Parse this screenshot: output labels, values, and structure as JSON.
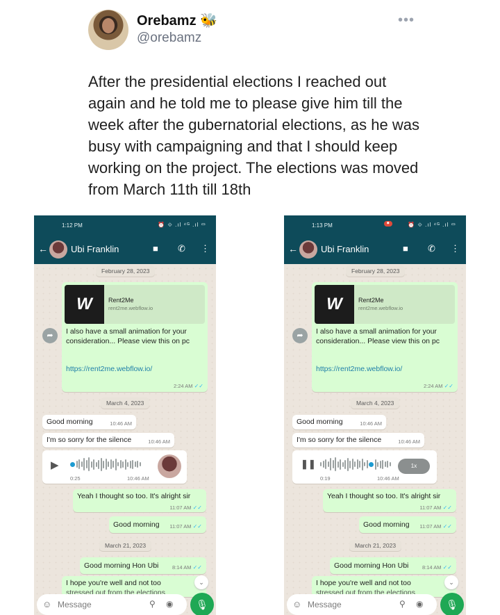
{
  "tweet": {
    "display_name": "Orebamz 🐝",
    "handle": "@orebamz",
    "more": "•••",
    "text": "After the presidential elections I reached out again and he told me to please give him till the week after the gubernatorial elections, as he was busy with campaigning and that I should keep working on the project. The elections was moved from March 11th till 18th"
  },
  "left": {
    "status_time": "1:12 PM",
    "status_icons": "⏰ ⟐ .ıl ⁴ᴳ .ıl ▭",
    "contact_name": "Ubi Franklin",
    "voice_duration": "0:25"
  },
  "right": {
    "status_time": "1:13 PM",
    "status_rec": "⏺",
    "status_icons": "⏰ ⟐ .ıl ⁴ᴳ .ıl ▭",
    "contact_name": "Ubi Franklin",
    "voice_duration": "0:19",
    "voice_speed": "1x"
  },
  "chat": {
    "date1": "February 28, 2023",
    "link_logo": "W",
    "link_title": "Rent2Me",
    "link_domain": "rent2me.webflow.io",
    "link_msg": "I also have a small animation for your consideration... Please view this on pc",
    "link_url": "https://rent2me.webflow.io/",
    "link_time": "2:24 AM",
    "date2": "March 4, 2023",
    "msg_good_morning": "Good morning",
    "msg_good_morning_time": "10:46 AM",
    "msg_sorry": "I'm so sorry for the silence",
    "msg_sorry_time": "10:46 AM",
    "voice_time": "10:46 AM",
    "msg_thought": "Yeah I thought so too. It's alright sir",
    "msg_thought_time": "11:07 AM",
    "msg_gm2": "Good morning",
    "msg_gm2_time": "11:07 AM",
    "date3": "March 21, 2023",
    "msg_hon": "Good morning Hon Ubi",
    "msg_hon_time": "8:14 AM",
    "msg_hope": "I hope you're well and not too",
    "msg_hope_cut": "stressed out from the elections",
    "input_placeholder": "Message",
    "ticks": "✓✓"
  }
}
